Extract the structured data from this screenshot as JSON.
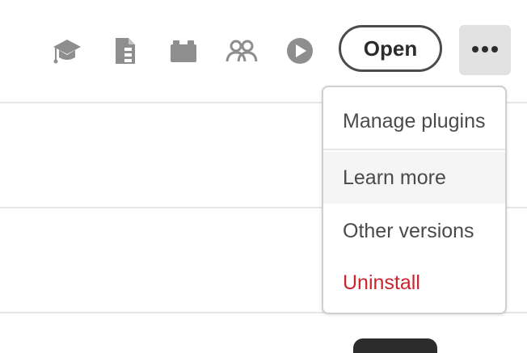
{
  "toolbar": {
    "icons": [
      "graduation-cap-icon",
      "document-icon",
      "plugin-icon",
      "community-icon",
      "play-icon"
    ],
    "open_label": "Open",
    "more_icon": "ellipsis-icon"
  },
  "menu": {
    "items": [
      {
        "label": "Manage plugins"
      },
      {
        "label": "Learn more"
      },
      {
        "label": "Other versions"
      },
      {
        "label": "Uninstall"
      }
    ]
  },
  "colors": {
    "icon_gray": "#8e8e8e",
    "danger": "#c9252d",
    "button_border": "#4b4b4b",
    "more_button_bg": "#e1e1e1"
  }
}
